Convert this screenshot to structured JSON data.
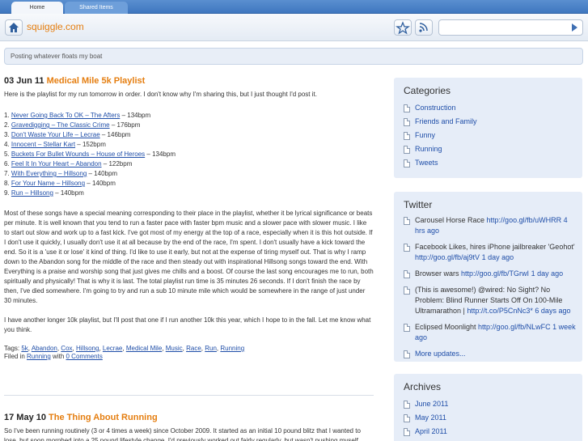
{
  "tabs": [
    {
      "label": "Home"
    },
    {
      "label": "Shared Items"
    }
  ],
  "header": {
    "site_name": "squiggle.com",
    "search_value": ""
  },
  "tagline": "Posting whatever floats my boat",
  "post1": {
    "date": "03 Jun 11",
    "title": "Medical Mile 5k Playlist",
    "intro": "Here is the playlist for my run tomorrow in order. I don't know why I'm sharing this, but I just thought I'd post it.",
    "tracks": [
      {
        "num": "1.",
        "title": "Never Going Back To OK – The Afters",
        "bpm": " – 134bpm"
      },
      {
        "num": "2.",
        "title": "Gravedigging – The Classic Crime",
        "bpm": " – 176bpm"
      },
      {
        "num": "3.",
        "title": "Don't Waste Your Life – Lecrae",
        "bpm": " – 146bpm"
      },
      {
        "num": "4.",
        "title": "Innocent – Stellar Kart",
        "bpm": " – 152bpm"
      },
      {
        "num": "5.",
        "title": "Buckets For Bullet Wounds – House of Heroes",
        "bpm": " – 134bpm"
      },
      {
        "num": "6.",
        "title": "Feel It In Your Heart – Abandon",
        "bpm": " – 122bpm"
      },
      {
        "num": "7.",
        "title": "With Everything – Hillsong",
        "bpm": " – 140bpm"
      },
      {
        "num": "8.",
        "title": "For Your Name – Hillsong",
        "bpm": " – 140bpm"
      },
      {
        "num": "9.",
        "title": "Run – Hillsong",
        "bpm": " – 140bpm"
      }
    ],
    "body": "Most of these songs have a special meaning corresponding to their place in the playlist, whether it be lyrical significance or beats per minute. It is well known that you tend to run a faster pace with faster bpm music and a slower pace with slower music. I like to start out slow and work up to a fast kick. I've got most of my energy at the top of a race, especially when it is this hot outside. If I don't use it quickly, I usually don't use it at all because by the end of the race, I'm spent. I don't usually have a kick toward the end. So it is a 'use it or lose' it kind of thing. I'd like to use it early, but not at the expense of tiring myself out. That is why I ramp down to the Abandon song for the middle of the race and then steady out with inspirational Hillsong songs toward the end. With Everything is a praise and worship song that just gives me chills and a boost. Of course the last song encourages me to run, both spiritually and physically! That is why it is last. The total playlist run time is 35 minutes 26 seconds. If I don't finish the race by then, I've died somewhere. I'm going to try and run a sub 10 minute mile which would be somewhere in the range of just under 30 minutes.",
    "outro": "I have another longer 10k playlist, but I'll post that one if I run another 10k this year, which I hope to in the fall. Let me know what you think.",
    "tags_label": "Tags: ",
    "tags": [
      "5k",
      "Abandon",
      "Cox",
      "Hillsong",
      "Lecrae",
      "Medical Mile",
      "Music",
      "Race",
      "Run",
      "Running"
    ],
    "filed_label": "Filed in ",
    "filed_category": "Running",
    "with_label": " with ",
    "comments": "0 Comments"
  },
  "post2": {
    "date": "17 May 10",
    "title": "The Thing About Running",
    "body": "So I've been running routinely (3 or 4 times a week) since October 2009. It started as an initial 10 pound blitz that I wanted to lose, but soon morphed into a 25 pound lifestyle change. I'd previously worked out fairly regularly, but wasn't pushing myself"
  },
  "sidebar": {
    "categories": {
      "title": "Categories",
      "items": [
        "Construction",
        "Friends and Family",
        "Funny",
        "Running",
        "Tweets"
      ]
    },
    "twitter": {
      "title": "Twitter",
      "items": [
        {
          "text": "Carousel Horse Race ",
          "link": "http://goo.gl/fb/uWHRR",
          "time": " 4 hrs ago"
        },
        {
          "text": "Facebook Likes, hires iPhone jailbreaker 'Geohot' ",
          "link": "http://goo.gl/fb/aj9tV",
          "time": " 1 day ago"
        },
        {
          "text": "Browser wars ",
          "link": "http://goo.gl/fb/TGrwI",
          "time": " 1 day ago"
        },
        {
          "text": "(This is awesome!) @wired: No Sight? No Problem: Blind Runner Starts Off On 100-Mile Ultramarathon | ",
          "link": "http://t.co/P5CnNc3",
          "time": "* 6 days ago"
        },
        {
          "text": "Eclipsed Moonlight ",
          "link": "http://goo.gl/fb/NLwFC",
          "time": " 1 week ago"
        }
      ],
      "more": "More updates..."
    },
    "archives": {
      "title": "Archives",
      "items": [
        "June 2011",
        "May 2011",
        "April 2011"
      ]
    }
  }
}
